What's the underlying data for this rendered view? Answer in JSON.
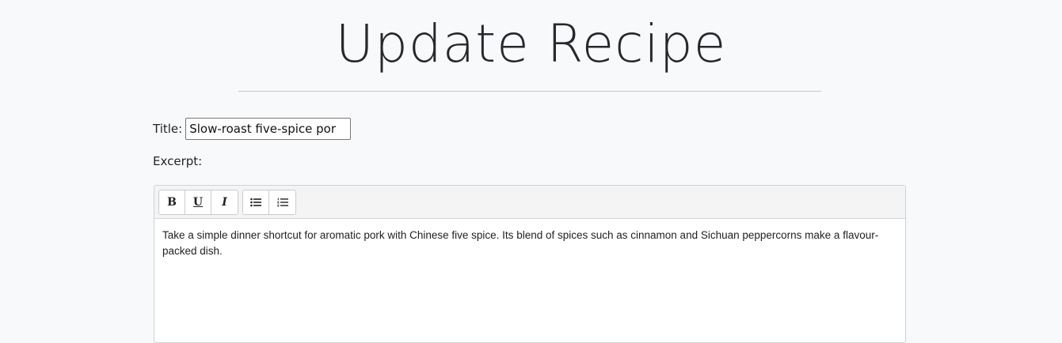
{
  "page": {
    "title": "Update Recipe"
  },
  "form": {
    "title_label": "Title:",
    "title_value": "Slow-roast five-spice por",
    "excerpt_label": "Excerpt:",
    "excerpt_text": "Take a simple dinner shortcut for aromatic pork with Chinese five spice. Its blend of spices such as cinnamon and Sichuan peppercorns make a flavour-packed dish."
  },
  "toolbar": {
    "bold_label": "B",
    "underline_label": "U",
    "italic_label": "I",
    "bulleted_list_icon": "bulleted-list-icon",
    "numbered_list_icon": "numbered-list-icon"
  }
}
